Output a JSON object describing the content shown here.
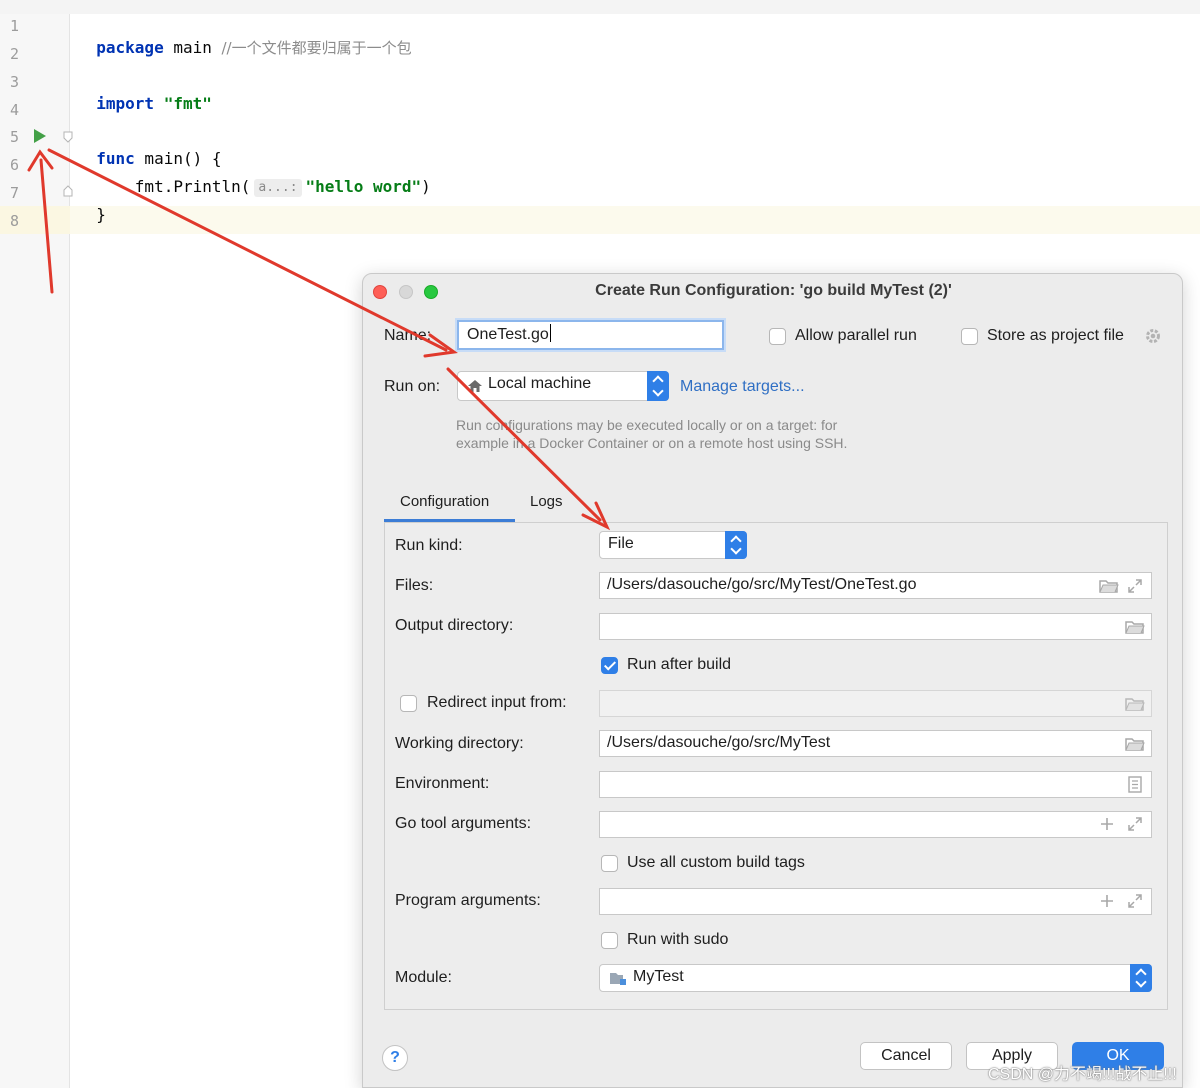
{
  "editor": {
    "line_numbers": [
      "1",
      "2",
      "3",
      "4",
      "5",
      "6",
      "7",
      "8"
    ],
    "line1": {
      "keyword": "package",
      "name": " main ",
      "comment": "//一个文件都要归属于一个包"
    },
    "line3": {
      "keyword": "import",
      "string": " \"fmt\""
    },
    "line5": {
      "keyword": "func",
      "rest": " main() {"
    },
    "line6": {
      "call": "    fmt.Println(",
      "hint": "a...:",
      "string": "\"hello word\"",
      "close": ")"
    },
    "line7": {
      "text": "}"
    }
  },
  "dialog": {
    "title": "Create Run Configuration: 'go build MyTest (2)'",
    "name_label": "Name:",
    "name_value": "OneTest.go",
    "allow_parallel_label": "Allow parallel run",
    "store_project_label": "Store as project file",
    "run_on_label": "Run on:",
    "run_on_value": "Local machine",
    "manage_targets": "Manage targets...",
    "run_on_desc_1": "Run configurations may be executed locally or on a target: for",
    "run_on_desc_2": "example in a Docker Container or on a remote host using SSH.",
    "tabs": [
      "Configuration",
      "Logs"
    ],
    "form": {
      "run_kind_label": "Run kind:",
      "run_kind_value": "File",
      "files_label": "Files:",
      "files_value": "/Users/dasouche/go/src/MyTest/OneTest.go",
      "output_dir_label": "Output directory:",
      "output_dir_value": "",
      "run_after_build_label": "Run after build",
      "redirect_input_label": "Redirect input from:",
      "redirect_input_value": "",
      "working_dir_label": "Working directory:",
      "working_dir_value": "/Users/dasouche/go/src/MyTest",
      "environment_label": "Environment:",
      "environment_value": "",
      "go_tool_args_label": "Go tool arguments:",
      "go_tool_args_value": "",
      "custom_build_tags_label": "Use all custom build tags",
      "program_args_label": "Program arguments:",
      "program_args_value": "",
      "run_with_sudo_label": "Run with sudo",
      "module_label": "Module:",
      "module_value": "MyTest"
    },
    "checkboxes": {
      "allow_parallel": false,
      "store_project": false,
      "run_after_build": true,
      "redirect_input": false,
      "custom_build_tags": false,
      "run_with_sudo": false
    },
    "buttons": {
      "help": "?",
      "cancel": "Cancel",
      "apply": "Apply",
      "ok": "OK"
    }
  },
  "watermark": "CSDN @力不竭!!!战不止!!!",
  "colors": {
    "accent": "#2f7fe7",
    "annotation_arrow": "#e0392c",
    "keyword": "#0033b3",
    "string": "#067d17",
    "run_icon": "#43a047"
  },
  "icons": [
    "run-icon",
    "fold-icon",
    "home-icon",
    "gear-icon",
    "folder-icon",
    "expand-icon",
    "list-icon",
    "plus-icon",
    "module-icon"
  ]
}
